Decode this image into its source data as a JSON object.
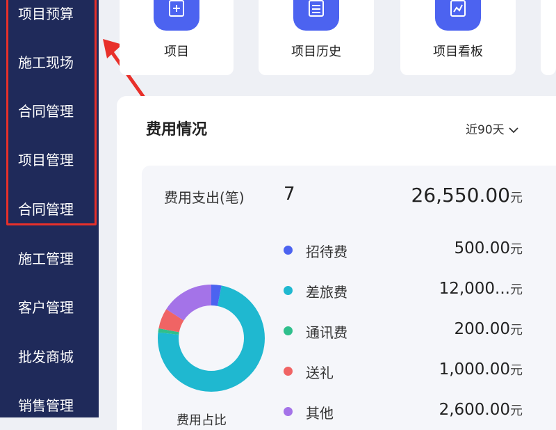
{
  "sidebar": {
    "items": [
      {
        "label": "项目预算"
      },
      {
        "label": "施工现场"
      },
      {
        "label": "合同管理"
      },
      {
        "label": "项目管理"
      },
      {
        "label": "合同管理"
      },
      {
        "label": "施工管理"
      },
      {
        "label": "客户管理"
      },
      {
        "label": "批发商城"
      },
      {
        "label": "销售管理"
      }
    ]
  },
  "quick_links": [
    {
      "label": "项目",
      "icon": "add-icon"
    },
    {
      "label": "项目历史",
      "icon": "list-icon"
    },
    {
      "label": "项目看板",
      "icon": "board-icon"
    }
  ],
  "expense": {
    "title": "费用情况",
    "range": "近90天",
    "summary_label": "费用支出(笔)",
    "count": "7",
    "total": "26,550.00",
    "unit": "元",
    "chart_caption": "费用占比",
    "categories": [
      {
        "name": "招待费",
        "value": "500.00",
        "color": "#4c63f0"
      },
      {
        "name": "差旅费",
        "value": "12,000...",
        "color": "#1fb8d0"
      },
      {
        "name": "通讯费",
        "value": "200.00",
        "color": "#2fbf8c"
      },
      {
        "name": "送礼",
        "value": "1,000.00",
        "color": "#f06464"
      },
      {
        "name": "其他",
        "value": "2,600.00",
        "color": "#a473e8"
      }
    ]
  },
  "colors": {
    "sidebar_bg": "#1f2a5a",
    "accent": "#4c63f0",
    "highlight": "#e8302a"
  }
}
